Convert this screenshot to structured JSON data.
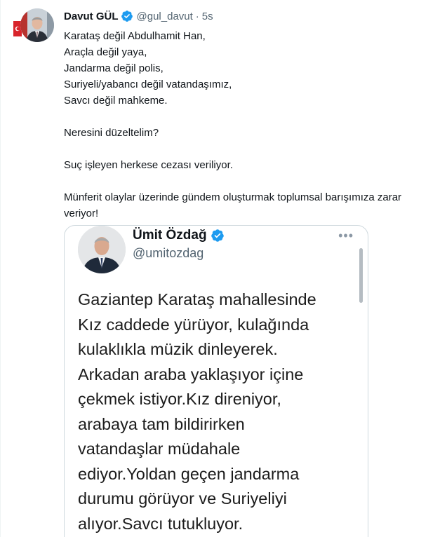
{
  "tweet": {
    "author_name": "Davut GÜL",
    "author_handle": "@gul_davut",
    "separator": "·",
    "time": "5s",
    "lines": [
      "Karataş değil Abdulhamit Han,",
      "Araçla değil yaya,",
      "Jandarma değil polis,",
      "Suriyeli/yabancı değil vatandaşımız,",
      "Savcı değil mahkeme.",
      "",
      "Neresini düzeltelim?",
      "",
      "Suç işleyen herkese cezası veriliyor.",
      "",
      "Münferit olaylar üzerinde gündem oluşturmak toplumsal barışımıza zarar veriyor!"
    ]
  },
  "quoted_tweet": {
    "author_name": "Ümit Özdağ",
    "author_handle": "@umitozdag",
    "more_icon": "more-dots-icon",
    "lines": [
      "Gaziantep Karataş mahallesinde",
      "Kız caddede yürüyor, kulağında",
      "kulaklıkla müzik dinleyerek.",
      "Arkadan araba yaklaşıyor içine",
      "çekmek istiyor.Kız direniyor,",
      "arabaya tam bildirirken",
      "vatandaşlar müdahale",
      "ediyor.Yoldan geçen jandarma",
      "durumu görüyor ve Suriyeliyi",
      "alıyor.Savcı tutukluyor."
    ]
  },
  "colors": {
    "verified_blue": "#1d9bf0",
    "secondary_text": "#536471",
    "primary_text": "#0f1419",
    "border": "#cfd9de"
  }
}
